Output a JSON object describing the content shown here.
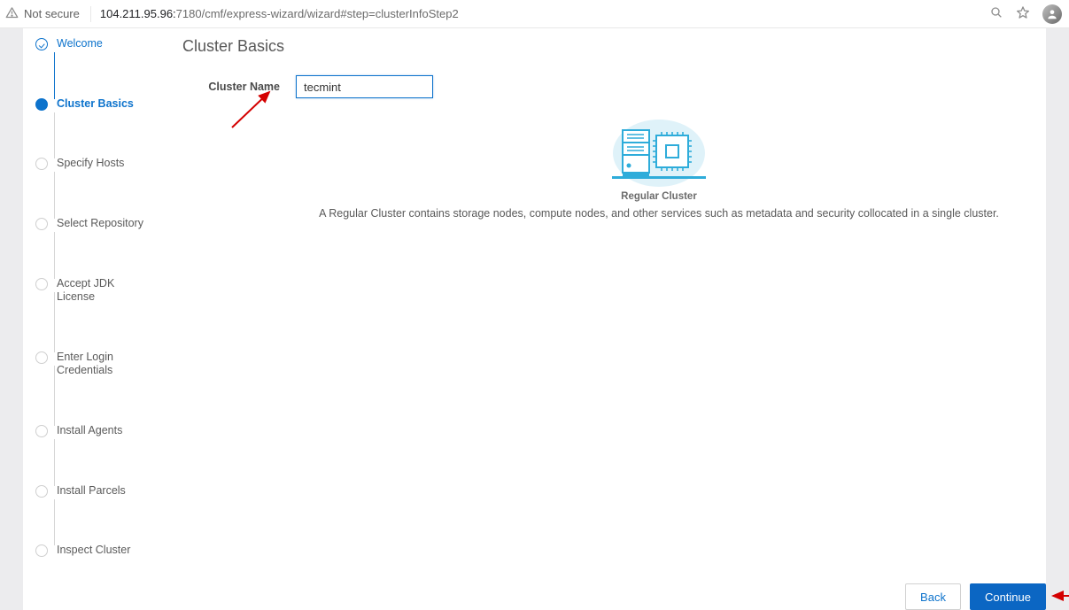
{
  "browser": {
    "security_label": "Not secure",
    "url_host": "104.211.95.96:",
    "url_port_path": "7180/cmf/express-wizard/wizard#step=clusterInfoStep2"
  },
  "wizard_steps": [
    {
      "id": "welcome",
      "label": "Welcome",
      "state": "done"
    },
    {
      "id": "cluster-basics",
      "label": "Cluster Basics",
      "state": "current"
    },
    {
      "id": "specify-hosts",
      "label": "Specify Hosts",
      "state": "todo"
    },
    {
      "id": "select-repo",
      "label": "Select Repository",
      "state": "todo"
    },
    {
      "id": "jdk",
      "label": "Accept JDK License",
      "state": "todo"
    },
    {
      "id": "login",
      "label": "Enter Login Credentials",
      "state": "todo"
    },
    {
      "id": "agents",
      "label": "Install Agents",
      "state": "todo"
    },
    {
      "id": "parcels",
      "label": "Install Parcels",
      "state": "todo"
    },
    {
      "id": "inspect",
      "label": "Inspect Cluster",
      "state": "todo"
    }
  ],
  "page": {
    "title": "Cluster Basics",
    "cluster_name_label": "Cluster Name",
    "cluster_name_value": "tecmint",
    "figure_caption": "Regular Cluster",
    "figure_description": "A Regular Cluster contains storage nodes, compute nodes, and other services such as metadata and security collocated in a single cluster."
  },
  "buttons": {
    "back": "Back",
    "continue": "Continue"
  }
}
